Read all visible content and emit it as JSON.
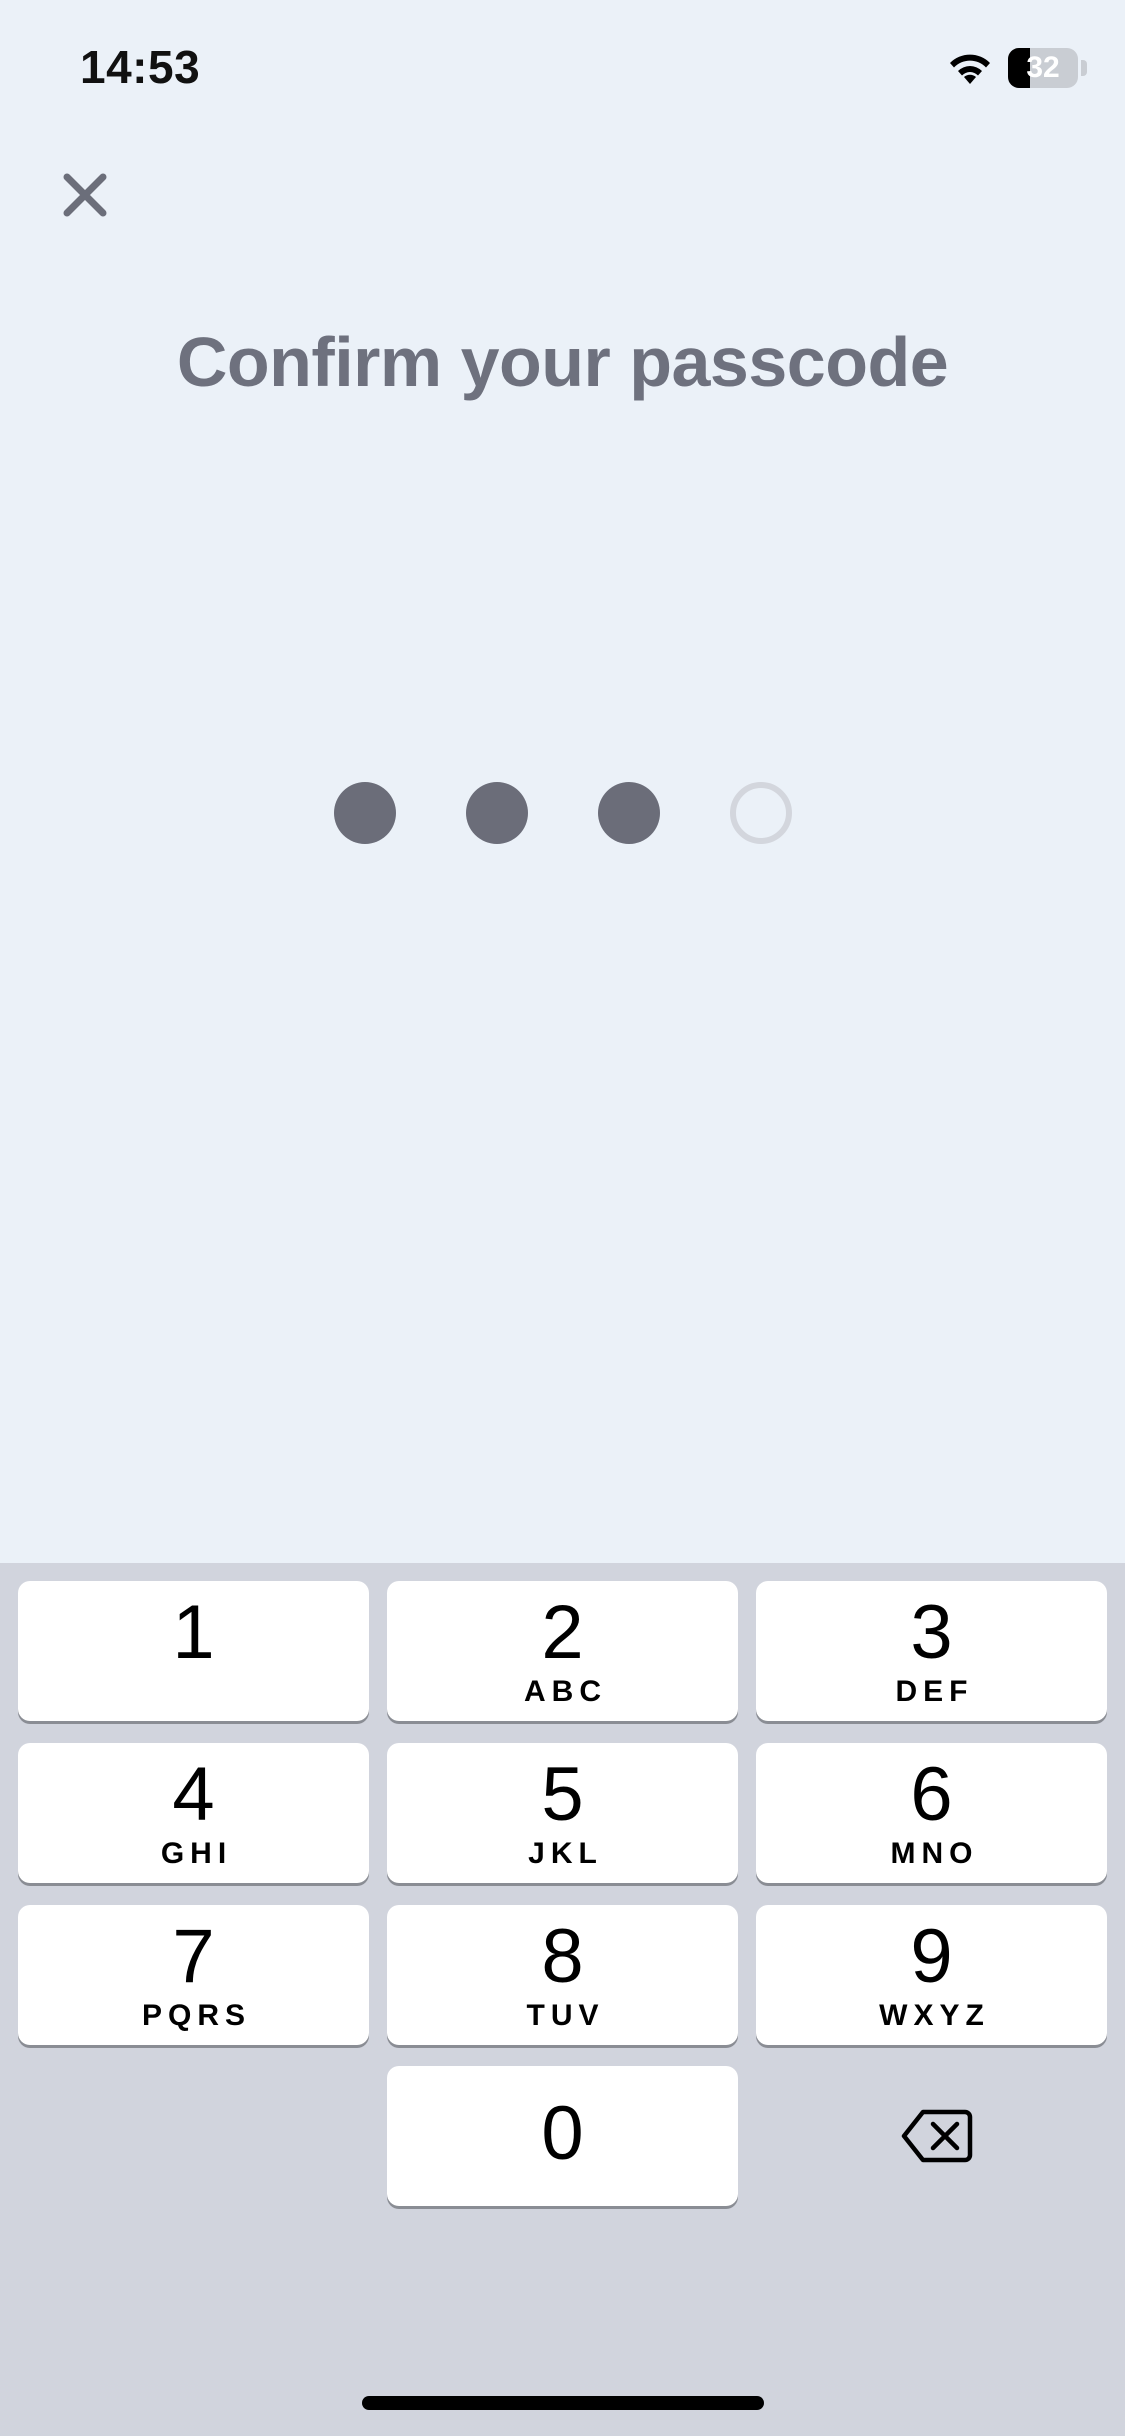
{
  "status_bar": {
    "time": "14:53",
    "battery_level": "32",
    "battery_fraction": 0.32,
    "icons": [
      "wifi-icon",
      "battery-icon"
    ]
  },
  "header": {
    "close_icon": "close-icon",
    "title": "Confirm your passcode"
  },
  "passcode": {
    "length": 4,
    "filled": 3
  },
  "keypad": {
    "keys": [
      {
        "digit": "1",
        "letters": ""
      },
      {
        "digit": "2",
        "letters": "ABC"
      },
      {
        "digit": "3",
        "letters": "DEF"
      },
      {
        "digit": "4",
        "letters": "GHI"
      },
      {
        "digit": "5",
        "letters": "JKL"
      },
      {
        "digit": "6",
        "letters": "MNO"
      },
      {
        "digit": "7",
        "letters": "PQRS"
      },
      {
        "digit": "8",
        "letters": "TUV"
      },
      {
        "digit": "9",
        "letters": "WXYZ"
      },
      {
        "digit": "0",
        "letters": ""
      }
    ],
    "backspace_icon": "backspace-icon"
  },
  "colors": {
    "background": "#ebf1f8",
    "title": "#6e717e",
    "dot_filled": "#6b6d79",
    "dot_empty": "#d3d6dd",
    "keypad_background": "#d1d4dd",
    "key": "#ffffff"
  }
}
